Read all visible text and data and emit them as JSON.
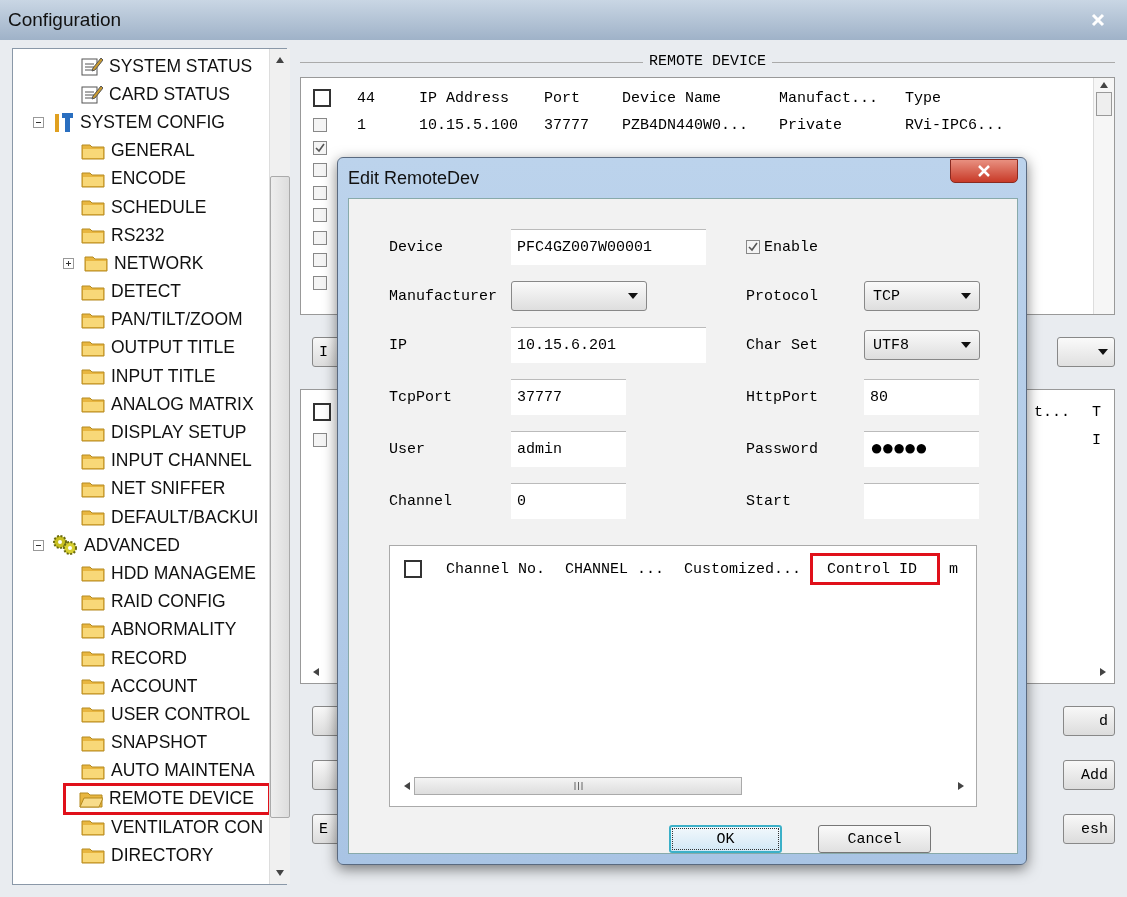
{
  "window": {
    "title": "Configuration"
  },
  "tree": {
    "continued_children": [
      {
        "label": "SYSTEM STATUS",
        "kind": "note",
        "selected": false,
        "highlighted": false
      },
      {
        "label": "CARD STATUS",
        "kind": "note",
        "selected": false,
        "highlighted": false
      }
    ],
    "items": [
      {
        "label": "SYSTEM CONFIG",
        "kind": "tools",
        "expanded": true,
        "selected": false,
        "highlighted": false,
        "children": [
          {
            "label": "GENERAL",
            "kind": "folder",
            "selected": false,
            "highlighted": false
          },
          {
            "label": "ENCODE",
            "kind": "folder",
            "selected": false,
            "highlighted": false
          },
          {
            "label": "SCHEDULE",
            "kind": "folder",
            "selected": false,
            "highlighted": false
          },
          {
            "label": "RS232",
            "kind": "folder",
            "selected": false,
            "highlighted": false
          },
          {
            "label": "NETWORK",
            "kind": "folder",
            "expanded": false,
            "selected": false,
            "highlighted": false
          },
          {
            "label": "DETECT",
            "kind": "folder",
            "selected": false,
            "highlighted": false
          },
          {
            "label": "PAN/TILT/ZOOM",
            "kind": "folder",
            "selected": false,
            "highlighted": false
          },
          {
            "label": "OUTPUT TITLE",
            "kind": "folder",
            "selected": false,
            "highlighted": false
          },
          {
            "label": "INPUT TITLE",
            "kind": "folder",
            "selected": false,
            "highlighted": false
          },
          {
            "label": "ANALOG MATRIX",
            "kind": "folder",
            "selected": false,
            "highlighted": false
          },
          {
            "label": "DISPLAY SETUP",
            "kind": "folder",
            "selected": false,
            "highlighted": false
          },
          {
            "label": "INPUT CHANNEL",
            "kind": "folder",
            "selected": false,
            "highlighted": false
          },
          {
            "label": "NET SNIFFER",
            "kind": "folder",
            "selected": false,
            "highlighted": false
          },
          {
            "label": "DEFAULT/BACKUI",
            "kind": "folder",
            "selected": false,
            "highlighted": false
          }
        ]
      },
      {
        "label": "ADVANCED",
        "kind": "gears",
        "expanded": true,
        "selected": false,
        "highlighted": false,
        "children": [
          {
            "label": "HDD MANAGEME",
            "kind": "folder",
            "selected": false,
            "highlighted": false
          },
          {
            "label": "RAID CONFIG",
            "kind": "folder",
            "selected": false,
            "highlighted": false
          },
          {
            "label": "ABNORMALITY",
            "kind": "folder",
            "selected": false,
            "highlighted": false
          },
          {
            "label": "RECORD",
            "kind": "folder",
            "selected": false,
            "highlighted": false
          },
          {
            "label": "ACCOUNT",
            "kind": "folder",
            "selected": false,
            "highlighted": false
          },
          {
            "label": "USER CONTROL",
            "kind": "folder",
            "selected": false,
            "highlighted": false
          },
          {
            "label": "SNAPSHOT",
            "kind": "folder",
            "selected": false,
            "highlighted": false
          },
          {
            "label": "AUTO MAINTENA",
            "kind": "folder",
            "selected": false,
            "highlighted": false
          },
          {
            "label": "REMOTE DEVICE",
            "kind": "folder",
            "selected": true,
            "highlighted": true
          },
          {
            "label": "VENTILATOR CON",
            "kind": "folder",
            "selected": false,
            "highlighted": false
          },
          {
            "label": "DIRECTORY",
            "kind": "folder",
            "selected": false,
            "highlighted": false
          }
        ]
      }
    ]
  },
  "group": {
    "title": "REMOTE DEVICE"
  },
  "device_table": {
    "header_checked": false,
    "columns": [
      "44",
      "IP Address",
      "Port",
      "Device Name",
      "Manufact...",
      "Type"
    ],
    "rows": [
      {
        "checked": false,
        "cells": [
          "1",
          "10.15.5.100",
          "37777",
          "PZB4DN440W0...",
          "Private",
          "RVi-IPC6..."
        ]
      },
      {
        "checked": true
      },
      {
        "checked": false
      },
      {
        "checked": false
      },
      {
        "checked": false
      },
      {
        "checked": false
      },
      {
        "checked": false
      },
      {
        "checked": false
      }
    ]
  },
  "upper_controls": [
    {
      "kind": "button",
      "text": "I"
    },
    {
      "kind": "select"
    }
  ],
  "lower_table": {
    "header_checked": false,
    "columns": [
      "t...",
      "T"
    ],
    "rows": [
      {
        "checked": false,
        "cells": [
          "",
          "I"
        ]
      }
    ]
  },
  "lower_controls": [
    [
      {
        "kind": "button"
      },
      {
        "kind": "button",
        "text": "d"
      }
    ],
    [
      {
        "kind": "button"
      },
      {
        "kind": "button",
        "text": "Add"
      }
    ],
    [
      {
        "kind": "button",
        "text": "E"
      },
      {
        "kind": "button",
        "text": "esh"
      }
    ]
  ],
  "dialog": {
    "title": "Edit RemoteDev",
    "rows": [
      {
        "left": {
          "kind": "text",
          "label": "Device",
          "value": "PFC4GZ007W00001"
        },
        "right": {
          "kind": "checkbox",
          "label": "Enable",
          "checked": true
        }
      },
      {
        "left": {
          "kind": "select",
          "label": "Manufacturer"
        },
        "right": {
          "kind": "select",
          "label": "Protocol",
          "value": "TCP"
        }
      },
      {
        "left": {
          "kind": "text",
          "label": "IP",
          "value": "10.15.6.201"
        },
        "right": {
          "kind": "select",
          "label": "Char Set",
          "value": "UTF8"
        }
      },
      {
        "left": {
          "kind": "text",
          "label": "TcpPort",
          "value": "37777"
        },
        "right": {
          "kind": "text",
          "label": "HttpPort",
          "value": "80"
        }
      },
      {
        "left": {
          "kind": "text",
          "label": "User",
          "value": "admin"
        },
        "right": {
          "kind": "password",
          "label": "Password",
          "value": "●●●●●"
        }
      },
      {
        "left": {
          "kind": "text",
          "label": "Channel",
          "value": "0"
        },
        "right": {
          "kind": "text",
          "label": "Start"
        }
      }
    ],
    "channel_table": {
      "header_checked": false,
      "columns": [
        {
          "text": "Channel No.",
          "highlighted": false
        },
        {
          "text": "CHANNEL ...",
          "highlighted": false
        },
        {
          "text": "Customized...",
          "highlighted": false
        },
        {
          "text": "Control ID",
          "highlighted": true
        },
        {
          "text": "m",
          "highlighted": false
        }
      ]
    },
    "buttons": [
      {
        "text": "OK",
        "kind": "default"
      },
      {
        "text": "Cancel",
        "kind": "normal"
      }
    ]
  }
}
